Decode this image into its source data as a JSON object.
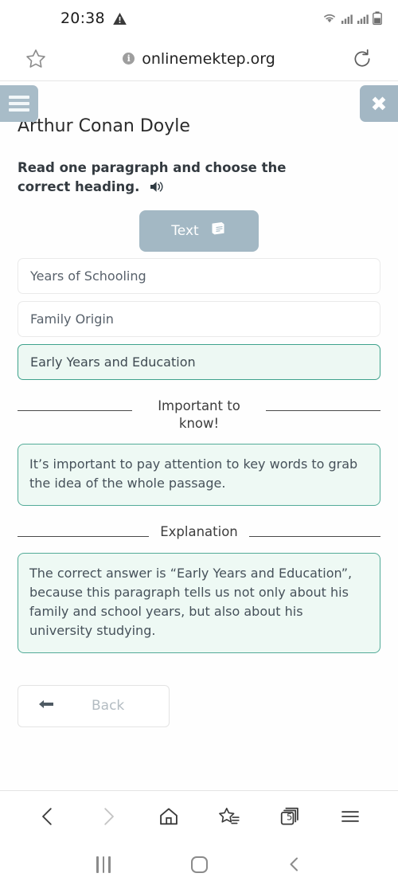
{
  "status_bar": {
    "time": "20:38",
    "icons": [
      "warning-triangle-icon",
      "wifi-icon",
      "signal-icon",
      "signal-icon",
      "battery-icon"
    ]
  },
  "browser": {
    "url": "onlinemektep.org",
    "bookmark_icon": "star-icon",
    "info_icon": "info-icon",
    "reload_icon": "reload-icon",
    "toolbar": {
      "back": "back-chevron-icon",
      "forward": "forward-chevron-icon",
      "home": "home-icon",
      "bookmarks": "star-list-icon",
      "tabs_label": "5",
      "menu": "hamburger-menu-icon"
    }
  },
  "page": {
    "menu_button_icon": "hamburger-menu-icon",
    "close_button_label": "✖",
    "title": "Arthur Conan Doyle",
    "prompt": "Read one paragraph and choose the correct heading.",
    "prompt_audio_icon": "speaker-icon",
    "text_tab": {
      "label": "Text",
      "icon": "book-icon"
    },
    "options": [
      {
        "label": "Years of Schooling",
        "selected": false
      },
      {
        "label": "Family Origin",
        "selected": false
      },
      {
        "label": "Early Years and Education",
        "selected": true
      }
    ],
    "important_section": {
      "heading": "Important to know!",
      "body": "It’s important to pay attention to key words to grab the idea of the whole passage."
    },
    "explanation_section": {
      "heading": "Explanation",
      "body": "The correct answer is “Early Years and Education”, because this paragraph tells us not only about his family and school years, but also about his university studying."
    },
    "back_button": {
      "label": "Back",
      "icon": "arrow-left-icon"
    }
  },
  "navigation_bar": {
    "recents": "recents-icon",
    "home": "home-circle-icon",
    "back": "back-chevron-icon"
  },
  "colors": {
    "accent_teal": "#3fa28c",
    "accent_bg": "#edf8f3",
    "button_blue_gray": "#a3b8c4"
  }
}
